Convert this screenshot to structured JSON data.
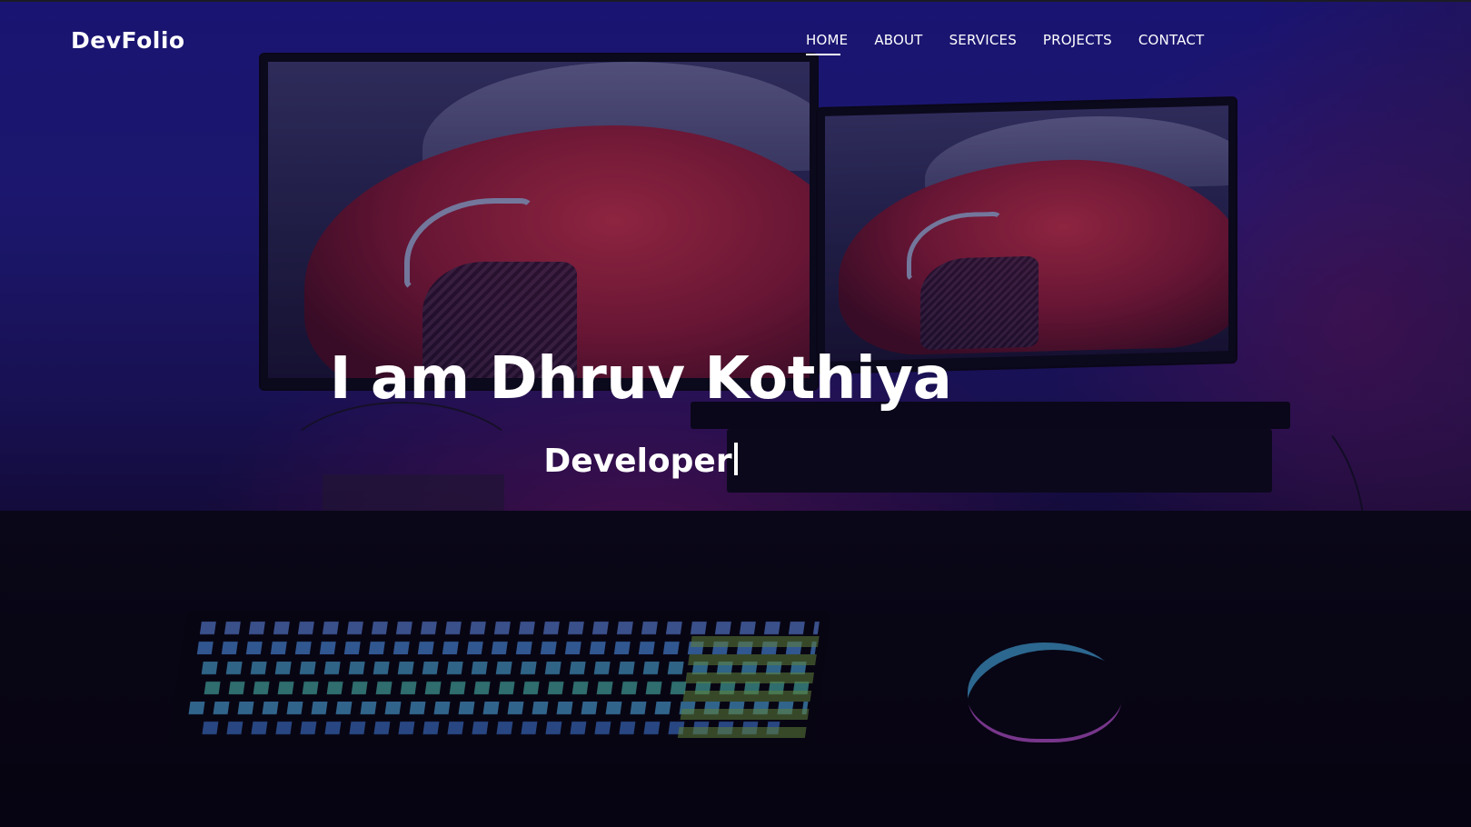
{
  "navbar": {
    "brand": "DevFolio",
    "items": [
      {
        "label": "HOME",
        "active": true
      },
      {
        "label": "ABOUT",
        "active": false
      },
      {
        "label": "SERVICES",
        "active": false
      },
      {
        "label": "PROJECTS",
        "active": false
      },
      {
        "label": "CONTACT",
        "active": false
      }
    ]
  },
  "hero": {
    "title": "I am Dhruv Kothiya",
    "typed_text": "Developer",
    "background_image": "desk-setup-with-dual-monitors-keyboard-mouse"
  },
  "colors": {
    "overlay": "#1f1a8f",
    "text": "#ffffff"
  }
}
